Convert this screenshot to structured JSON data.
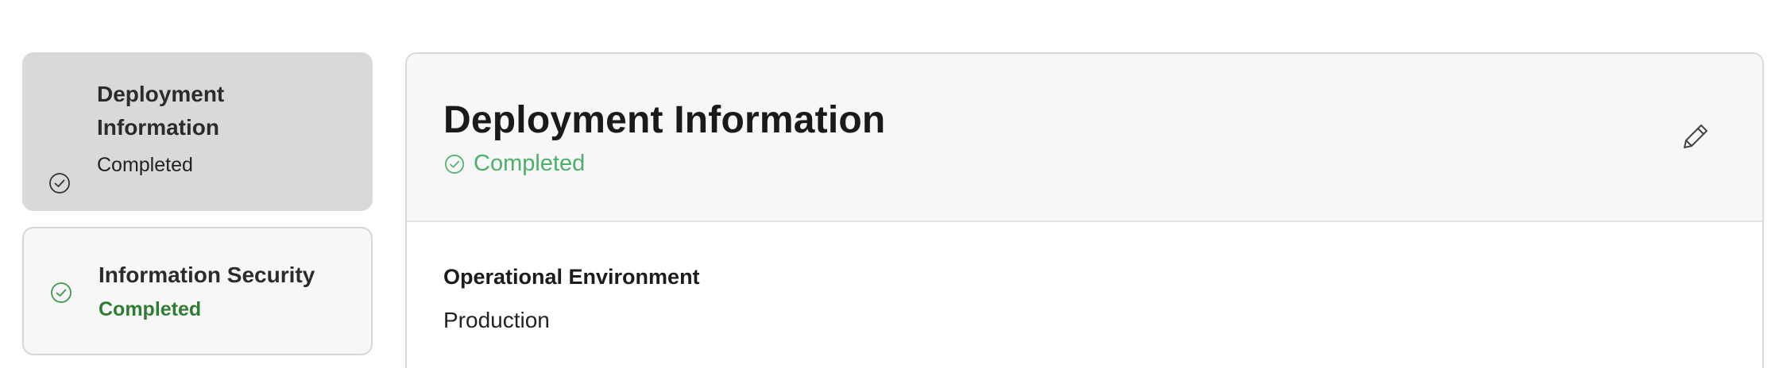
{
  "sidebar": {
    "steps": [
      {
        "title": "Deployment Information",
        "status": "Completed",
        "icon": "check-circle-icon",
        "state": "active"
      },
      {
        "title": "Information Security",
        "status": "Completed",
        "icon": "check-circle-icon",
        "state": "inactive"
      }
    ]
  },
  "main": {
    "title": "Deployment Information",
    "status": "Completed",
    "status_icon": "check-circle-icon",
    "edit_icon": "pencil-icon",
    "fields": [
      {
        "label": "Operational Environment",
        "value": "Production"
      }
    ]
  },
  "colors": {
    "active_card_bg": "#d9d9d9",
    "inactive_card_bg": "#f7f7f7",
    "success_green": "#4caf6a",
    "success_green_dark": "#2f7d32"
  }
}
